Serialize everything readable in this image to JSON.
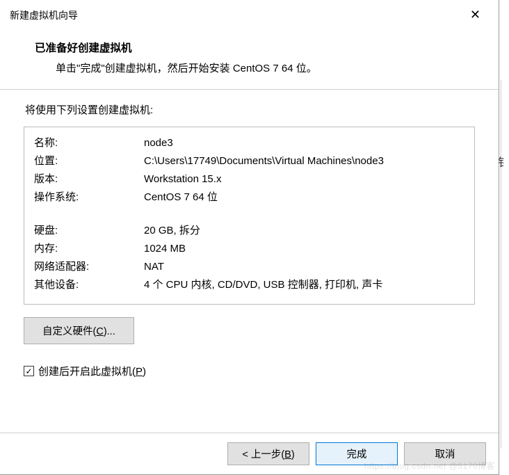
{
  "titlebar": {
    "title": "新建虚拟机向导"
  },
  "header": {
    "title": "已准备好创建虚拟机",
    "sub": "单击\"完成\"创建虚拟机，然后开始安装 CentOS 7 64 位。"
  },
  "intro": "将使用下列设置创建虚拟机:",
  "settings": [
    {
      "k": "名称:",
      "v": "node3"
    },
    {
      "k": "位置:",
      "v": "C:\\Users\\17749\\Documents\\Virtual Machines\\node3"
    },
    {
      "k": "版本:",
      "v": "Workstation 15.x"
    },
    {
      "k": "操作系统:",
      "v": "CentOS 7 64 位"
    }
  ],
  "settings2": [
    {
      "k": "硬盘:",
      "v": "20 GB, 拆分"
    },
    {
      "k": "内存:",
      "v": "1024 MB"
    },
    {
      "k": "网络适配器:",
      "v": "NAT"
    },
    {
      "k": "其他设备:",
      "v": "4 个 CPU 内核, CD/DVD, USB 控制器, 打印机, 声卡"
    }
  ],
  "custom_btn_pre": "自定义硬件(",
  "custom_btn_u": "C",
  "custom_btn_post": ")...",
  "checkbox_pre": "创建后开启此虚拟机(",
  "checkbox_u": "P",
  "checkbox_post": ")",
  "checkbox_checked": true,
  "footer": {
    "back_pre": "< 上一步(",
    "back_u": "B",
    "back_post": ")",
    "finish": "完成",
    "cancel": "取消"
  },
  "side_char": "钅",
  "watermark": "https://blog.csdn.net @5170博客"
}
